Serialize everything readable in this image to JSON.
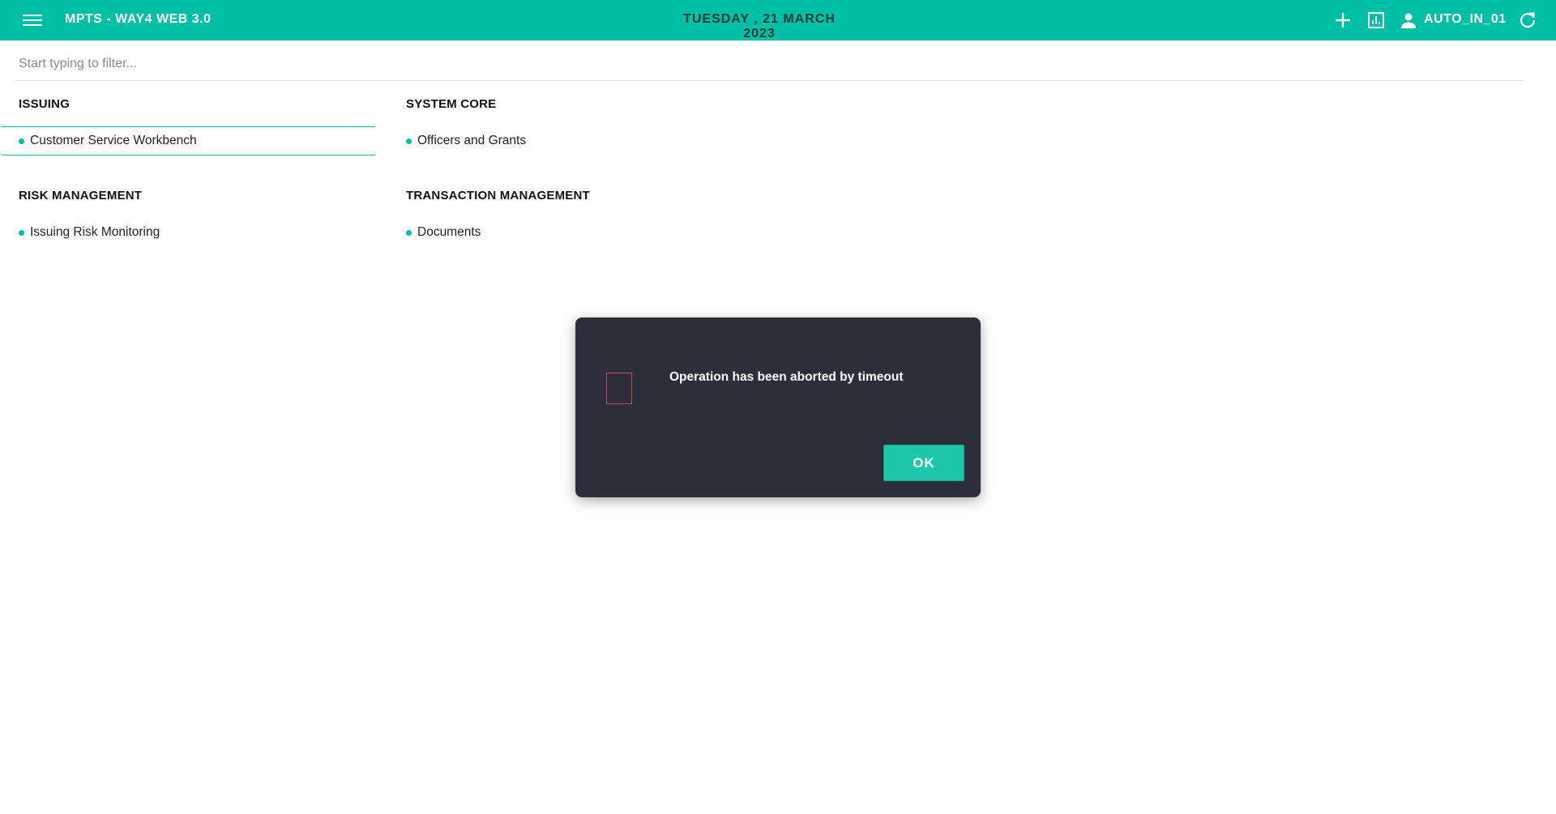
{
  "header": {
    "title": "MPTS - WAY4 WEB 3.0",
    "date": "TUESDAY , 21 MARCH 2023",
    "user": "AUTO_IN_01",
    "icons": [
      "menu-icon",
      "plus-icon",
      "report-icon",
      "user-icon",
      "refresh-icon"
    ],
    "accent_color": "#00bfa5"
  },
  "filter": {
    "placeholder": "Start typing to filter...",
    "value": ""
  },
  "groups": [
    {
      "title": "ISSUING",
      "items": [
        "Customer Service Workbench"
      ]
    },
    {
      "title": "SYSTEM CORE",
      "items": [
        "Officers and Grants"
      ]
    },
    {
      "title": "RISK MANAGEMENT",
      "items": [
        "Issuing Risk Monitoring"
      ]
    },
    {
      "title": "TRANSACTION MANAGEMENT",
      "items": [
        "Documents"
      ]
    }
  ],
  "dialog": {
    "message": "Operation has been aborted by timeout",
    "ok_label": "OK",
    "background_color": "#2e2e3a"
  }
}
